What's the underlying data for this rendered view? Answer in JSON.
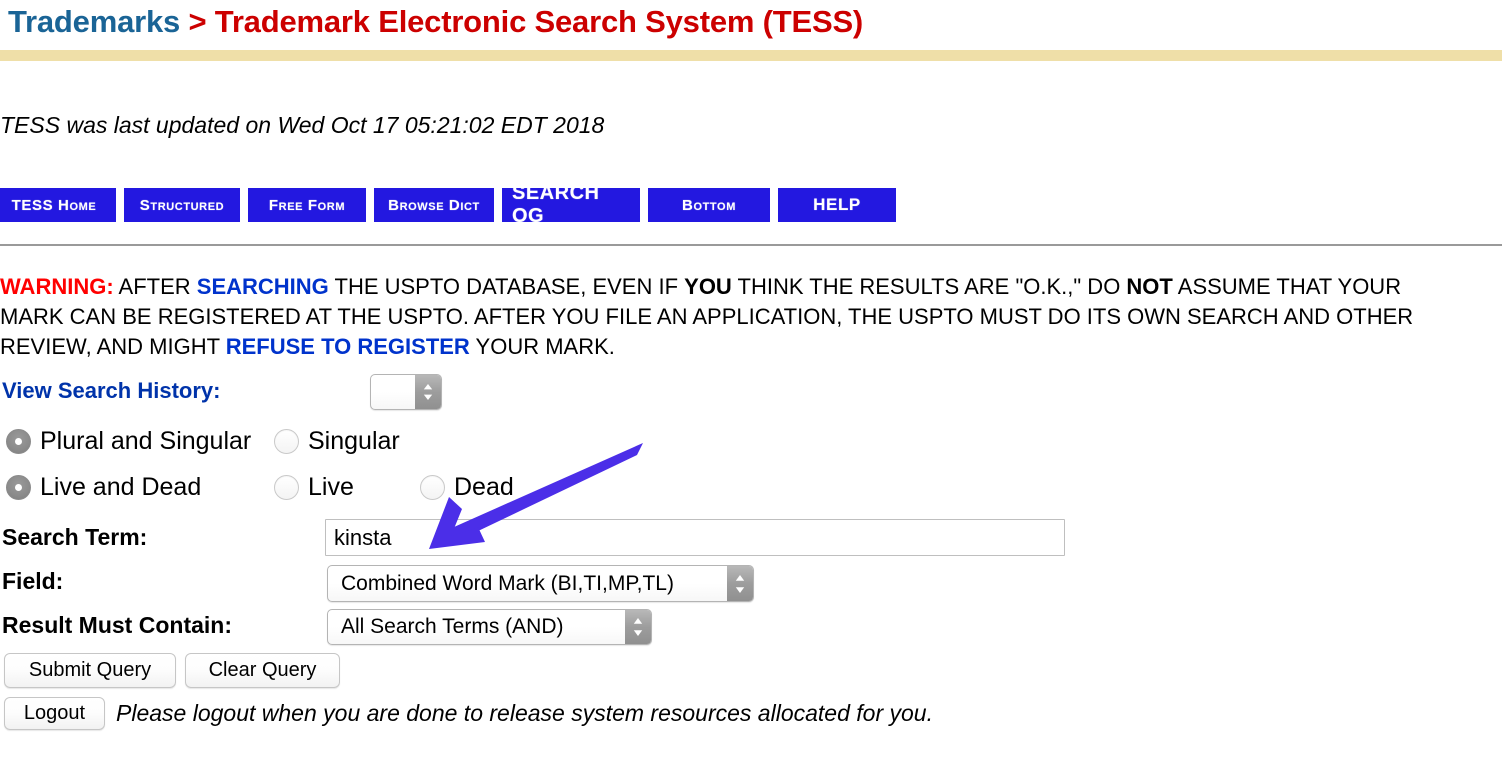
{
  "header": {
    "breadcrumb_primary": "Trademarks",
    "breadcrumb_separator": " > ",
    "breadcrumb_secondary": "Trademark Electronic Search System (TESS)",
    "accent_blue": "#1a6496",
    "accent_red": "#cc0000",
    "divider_color": "#efdfa8"
  },
  "status": {
    "last_updated": "TESS was last updated on Wed Oct 17 05:21:02 EDT 2018"
  },
  "nav": {
    "buttons": [
      {
        "label": "TESS Home"
      },
      {
        "label": "Structured"
      },
      {
        "label": "Free Form"
      },
      {
        "label": "Browse Dict"
      },
      {
        "label": "SEARCH OG"
      },
      {
        "label": "Bottom"
      },
      {
        "label": "HELP"
      }
    ],
    "button_color": "#2318e0"
  },
  "warning": {
    "prefix": "WARNING:",
    "seg_1": " AFTER ",
    "link_searching": "SEARCHING",
    "seg_2": " THE USPTO DATABASE, EVEN IF ",
    "bold_you": "YOU",
    "seg_3": " THINK THE RESULTS ARE \"O.K.,\" DO ",
    "bold_not": "NOT",
    "seg_4": " ASSUME THAT YOUR MARK CAN BE REGISTERED AT THE USPTO. AFTER YOU FILE AN APPLICATION, THE USPTO MUST DO ITS OWN SEARCH AND OTHER REVIEW, AND MIGHT ",
    "link_refuse": "REFUSE TO REGISTER",
    "seg_5": " YOUR MARK."
  },
  "form": {
    "view_history_label": "View Search History:",
    "view_history_value": "",
    "scope_options": [
      {
        "label": "Plural and Singular",
        "selected": true
      },
      {
        "label": "Singular",
        "selected": false
      }
    ],
    "status_options": [
      {
        "label": "Live and Dead",
        "selected": true
      },
      {
        "label": "Live",
        "selected": false
      },
      {
        "label": "Dead",
        "selected": false
      }
    ],
    "search_term_label": "Search Term:",
    "search_term_value": "kinsta",
    "search_term_placeholder": "",
    "field_label": "Field:",
    "field_value": "Combined Word Mark (BI,TI,MP,TL)",
    "result_label": "Result Must Contain:",
    "result_value": "All Search Terms (AND)",
    "submit_label": "Submit Query",
    "clear_label": "Clear Query",
    "logout_label": "Logout",
    "logout_note": "Please logout when you are done to release system resources allocated for you."
  },
  "annotation": {
    "arrow_color": "#4b2ee8",
    "arrow_points_to": "search-term-input"
  }
}
